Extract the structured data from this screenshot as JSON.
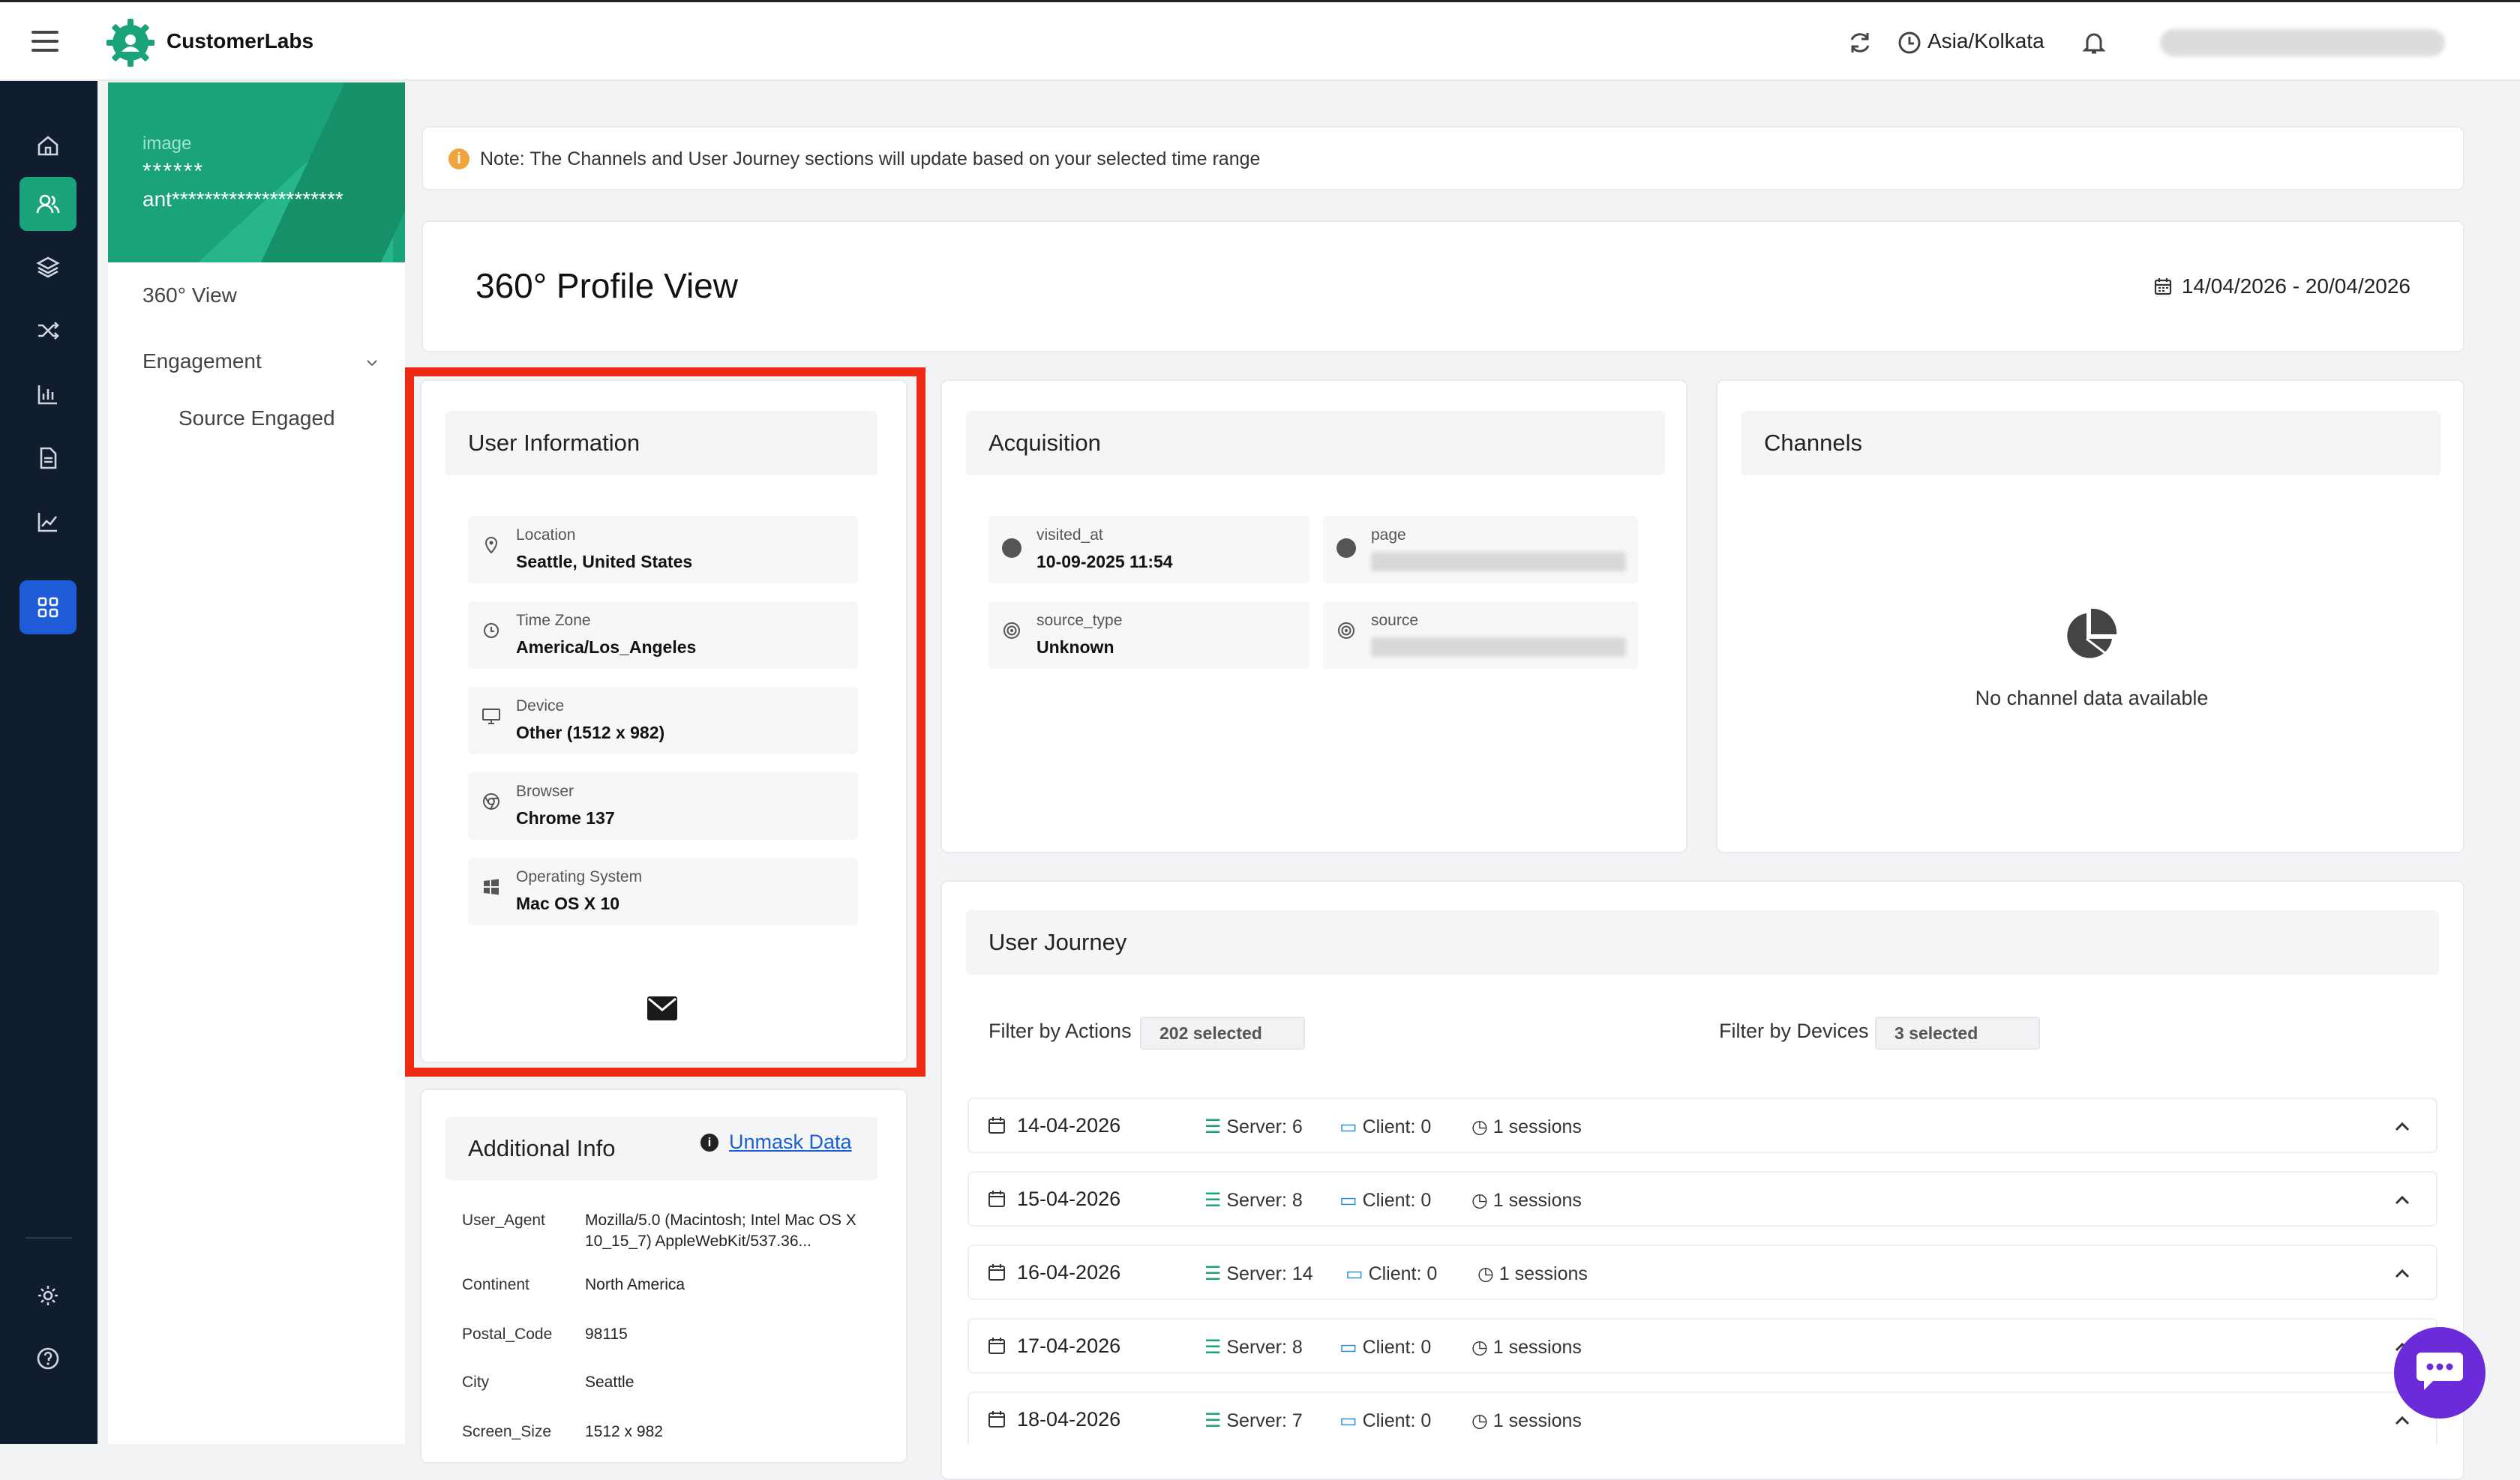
{
  "app": {
    "brand": "CustomerLabs",
    "timezone": "Asia/Kolkata"
  },
  "profile_card": {
    "image_alt": "image",
    "mask_line1": "******",
    "mask_line2": "ant*********************"
  },
  "subnav": {
    "view": "360° View",
    "engagement": "Engagement",
    "source_engaged": "Source Engaged"
  },
  "note": {
    "text": "Note: The Channels and User Journey sections will update based on your selected time range"
  },
  "profile": {
    "title": "360° Profile View",
    "date_range": "14/04/2026 - 20/04/2026"
  },
  "user_info": {
    "title": "User Information",
    "rows": [
      {
        "label": "Location",
        "value": "Seattle, United States",
        "icon": "map-pin-icon"
      },
      {
        "label": "Time Zone",
        "value": "America/Los_Angeles",
        "icon": "clock-icon"
      },
      {
        "label": "Device",
        "value": "Other (1512 x 982)",
        "icon": "monitor-icon"
      },
      {
        "label": "Browser",
        "value": "Chrome 137",
        "icon": "chrome-icon"
      },
      {
        "label": "Operating System",
        "value": "Mac OS X 10",
        "icon": "windows-icon"
      }
    ]
  },
  "acquisition": {
    "title": "Acquisition",
    "items": [
      {
        "label": "visited_at",
        "value": "10-09-2025 11:54"
      },
      {
        "label": "page",
        "value": ""
      },
      {
        "label": "source_type",
        "value": "Unknown"
      },
      {
        "label": "source",
        "value": ""
      }
    ]
  },
  "channels": {
    "title": "Channels",
    "empty": "No channel data available"
  },
  "additional_info": {
    "title": "Additional Info",
    "unmask": "Unmask Data",
    "rows": [
      {
        "key": "User_Agent",
        "value": "Mozilla/5.0 (Macintosh; Intel Mac OS X 10_15_7) AppleWebKit/537.36..."
      },
      {
        "key": "Continent",
        "value": "North America"
      },
      {
        "key": "Postal_Code",
        "value": "98115"
      },
      {
        "key": "City",
        "value": "Seattle"
      },
      {
        "key": "Screen_Size",
        "value": "1512 x 982"
      }
    ]
  },
  "journey": {
    "title": "User Journey",
    "filter_actions_label": "Filter by Actions",
    "filter_actions_value": "202 selected",
    "filter_devices_label": "Filter by Devices",
    "filter_devices_value": "3 selected",
    "days": [
      {
        "date": "14-04-2026",
        "server": "Server: 6",
        "client": "Client: 0",
        "sessions": "1 sessions"
      },
      {
        "date": "15-04-2026",
        "server": "Server: 8",
        "client": "Client: 0",
        "sessions": "1 sessions"
      },
      {
        "date": "16-04-2026",
        "server": "Server: 14",
        "client": "Client: 0",
        "sessions": "1 sessions"
      },
      {
        "date": "17-04-2026",
        "server": "Server: 8",
        "client": "Client: 0",
        "sessions": "1 sessions"
      },
      {
        "date": "18-04-2026",
        "server": "Server: 7",
        "client": "Client: 0",
        "sessions": "1 sessions"
      }
    ]
  },
  "colors": {
    "accent": "#1aa37a",
    "rail": "#0f1d2e",
    "active_blue": "#1e5bd6",
    "highlight": "#ee2a14",
    "chat": "#6c2bd9"
  }
}
